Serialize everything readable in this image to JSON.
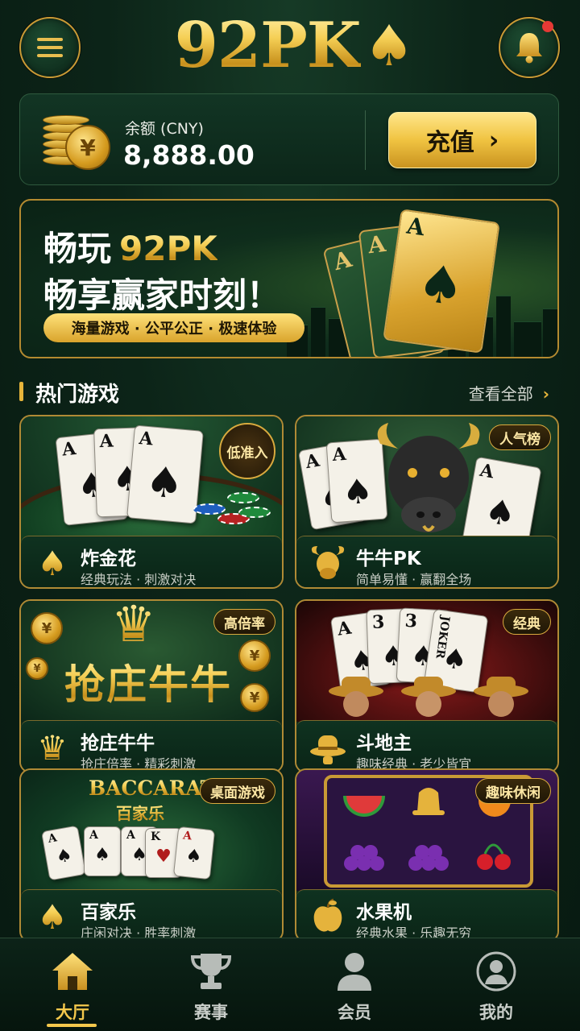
{
  "header": {
    "logo_text": "92PK",
    "logo_suit": "♠",
    "menu_icon": "menu-icon",
    "bell_icon": "bell-icon",
    "has_notification": true
  },
  "balance": {
    "label": "余额 (CNY)",
    "value": "8,888.00",
    "currency_symbol": "¥",
    "recharge_label": "充值",
    "recharge_chevron": "›"
  },
  "banner": {
    "line1_prefix": "畅玩",
    "line1_highlight": "92PK",
    "line2": "畅享赢家时刻！",
    "tagline": "海量游戏 · 公平公正 · 极速体验",
    "card_ranks": [
      "A",
      "A",
      "A"
    ],
    "card_suit": "♠"
  },
  "section": {
    "title": "热门游戏",
    "view_all": "查看全部",
    "chevron": "›"
  },
  "games": [
    {
      "title": "炸金花",
      "desc": "经典玩法 · 刺激对决",
      "tag": "低准入",
      "icon": "spade-icon",
      "icon_glyph": "♠"
    },
    {
      "title": "牛牛PK",
      "desc": "简单易懂 · 赢翻全场",
      "tag": "人气榜",
      "icon": "bull-icon",
      "icon_glyph": "🐂"
    },
    {
      "title": "抢庄牛牛",
      "desc": "抢庄倍率 · 精彩刺激",
      "tag": "高倍率",
      "icon": "crown-icon",
      "icon_glyph": "♛",
      "art_text": "抢庄牛牛"
    },
    {
      "title": "斗地主",
      "desc": "趣味经典 · 老少皆宜",
      "tag": "经典",
      "icon": "hat-icon",
      "icon_glyph": "🎩"
    },
    {
      "title": "百家乐",
      "desc": "庄闲对决 · 胜率刺激",
      "tag": "桌面游戏",
      "icon": "spade-icon",
      "icon_glyph": "♠",
      "art_text_en": "BACCARAT",
      "art_text_cn": "百家乐"
    },
    {
      "title": "水果机",
      "desc": "经典水果 · 乐趣无穷",
      "tag": "趣味休闲",
      "icon": "apple-icon",
      "icon_glyph": "🍎"
    }
  ],
  "card_art": {
    "ace": "A",
    "three": "3",
    "king": "K",
    "joker": "JOKER",
    "spade": "♠",
    "heart": "♥",
    "coin": "¥"
  },
  "nav": [
    {
      "label": "大厅",
      "icon": "home-icon",
      "active": true
    },
    {
      "label": "赛事",
      "icon": "trophy-icon",
      "active": false
    },
    {
      "label": "会员",
      "icon": "member-icon",
      "active": false
    },
    {
      "label": "我的",
      "icon": "profile-icon",
      "active": false
    }
  ],
  "colors": {
    "background": "#0c2418",
    "gold": "#e6b53a",
    "accent_red": "#e53935"
  }
}
